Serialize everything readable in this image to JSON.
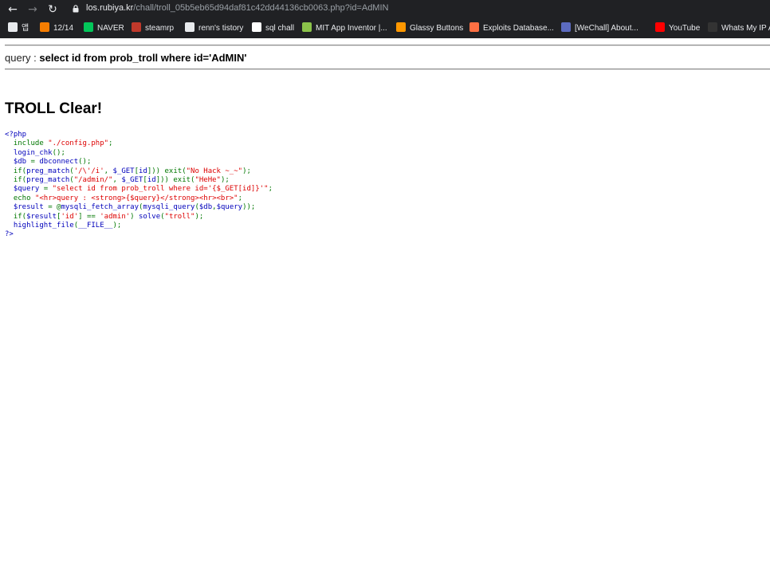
{
  "browser": {
    "url_host": "los.rubiya.kr",
    "url_path": "/chall/troll_05b5eb65d94daf81c42dd44136cb0063.php?id=AdMIN",
    "bookmarks": [
      {
        "label": "앱",
        "icon": "apps-grid-icon",
        "color": "#e8eaed"
      },
      {
        "label": "12/14",
        "icon": "blogger-icon",
        "color": "#f57d00"
      },
      {
        "label": "NAVER",
        "icon": "naver-icon",
        "color": "#03c75a"
      },
      {
        "label": "steamrp",
        "icon": "steamrp-icon",
        "color": "#c0392b"
      },
      {
        "label": "renn's tistory",
        "icon": "tistory-icon",
        "color": "#e8eaed"
      },
      {
        "label": "sql chall",
        "icon": "z-icon",
        "color": "#ffffff"
      },
      {
        "label": "MIT App Inventor |...",
        "icon": "mit-app-inventor-icon",
        "color": "#8bc34a"
      },
      {
        "label": "Glassy Buttons",
        "icon": "glassy-buttons-icon",
        "color": "#ff9800"
      },
      {
        "label": "Exploits Database...",
        "icon": "exploit-db-icon",
        "color": "#ff7043"
      },
      {
        "label": "[WeChall] About...",
        "icon": "wechall-icon",
        "color": "#5c6bc0"
      },
      {
        "label": "YouTube",
        "icon": "youtube-icon",
        "color": "#ff0000"
      },
      {
        "label": "Whats My IP A",
        "icon": "whatsmyip-icon",
        "color": "#333333"
      }
    ]
  },
  "page": {
    "query_prefix": "query : ",
    "query_text": "select id from prob_troll where id='AdMIN'",
    "clear_heading": "TROLL Clear!"
  },
  "source_code": [
    [
      {
        "t": "<?php",
        "c": "def"
      }
    ],
    [
      {
        "t": "  include ",
        "c": "kw"
      },
      {
        "t": "\"./config.php\"",
        "c": "str"
      },
      {
        "t": ";",
        "c": "kw"
      }
    ],
    [
      {
        "t": "  login_chk",
        "c": "def"
      },
      {
        "t": "();",
        "c": "kw"
      }
    ],
    [
      {
        "t": "  $db ",
        "c": "def"
      },
      {
        "t": "= ",
        "c": "kw"
      },
      {
        "t": "dbconnect",
        "c": "def"
      },
      {
        "t": "();",
        "c": "kw"
      }
    ],
    [
      {
        "t": "  if(",
        "c": "kw"
      },
      {
        "t": "preg_match",
        "c": "def"
      },
      {
        "t": "(",
        "c": "kw"
      },
      {
        "t": "'/\\'/i'",
        "c": "str"
      },
      {
        "t": ", ",
        "c": "kw"
      },
      {
        "t": "$_GET",
        "c": "def"
      },
      {
        "t": "[",
        "c": "kw"
      },
      {
        "t": "id",
        "c": "def"
      },
      {
        "t": "])) exit(",
        "c": "kw"
      },
      {
        "t": "\"No Hack ~_~\"",
        "c": "str"
      },
      {
        "t": ");",
        "c": "kw"
      }
    ],
    [
      {
        "t": "  if(",
        "c": "kw"
      },
      {
        "t": "preg_match",
        "c": "def"
      },
      {
        "t": "(",
        "c": "kw"
      },
      {
        "t": "\"/admin/\"",
        "c": "str"
      },
      {
        "t": ", ",
        "c": "kw"
      },
      {
        "t": "$_GET",
        "c": "def"
      },
      {
        "t": "[",
        "c": "kw"
      },
      {
        "t": "id",
        "c": "def"
      },
      {
        "t": "])) exit(",
        "c": "kw"
      },
      {
        "t": "\"HeHe\"",
        "c": "str"
      },
      {
        "t": ");",
        "c": "kw"
      }
    ],
    [
      {
        "t": "  $query ",
        "c": "def"
      },
      {
        "t": "= ",
        "c": "kw"
      },
      {
        "t": "\"select id from prob_troll where id='{$_GET[id]}'\"",
        "c": "str"
      },
      {
        "t": ";",
        "c": "kw"
      }
    ],
    [
      {
        "t": "  echo ",
        "c": "kw"
      },
      {
        "t": "\"<hr>query : <strong>{$query}</strong><hr><br>\"",
        "c": "str"
      },
      {
        "t": ";",
        "c": "kw"
      }
    ],
    [
      {
        "t": "  $result ",
        "c": "def"
      },
      {
        "t": "= @",
        "c": "kw"
      },
      {
        "t": "mysqli_fetch_array",
        "c": "def"
      },
      {
        "t": "(",
        "c": "kw"
      },
      {
        "t": "mysqli_query",
        "c": "def"
      },
      {
        "t": "(",
        "c": "kw"
      },
      {
        "t": "$db",
        "c": "def"
      },
      {
        "t": ",",
        "c": "kw"
      },
      {
        "t": "$query",
        "c": "def"
      },
      {
        "t": "));",
        "c": "kw"
      }
    ],
    [
      {
        "t": "  if(",
        "c": "kw"
      },
      {
        "t": "$result",
        "c": "def"
      },
      {
        "t": "[",
        "c": "kw"
      },
      {
        "t": "'id'",
        "c": "str"
      },
      {
        "t": "] == ",
        "c": "kw"
      },
      {
        "t": "'admin'",
        "c": "str"
      },
      {
        "t": ") ",
        "c": "kw"
      },
      {
        "t": "solve",
        "c": "def"
      },
      {
        "t": "(",
        "c": "kw"
      },
      {
        "t": "\"troll\"",
        "c": "str"
      },
      {
        "t": ");",
        "c": "kw"
      }
    ],
    [
      {
        "t": "  highlight_file",
        "c": "def"
      },
      {
        "t": "(",
        "c": "kw"
      },
      {
        "t": "__FILE__",
        "c": "def"
      },
      {
        "t": ");",
        "c": "kw"
      }
    ],
    [
      {
        "t": "?>",
        "c": "def"
      }
    ]
  ]
}
